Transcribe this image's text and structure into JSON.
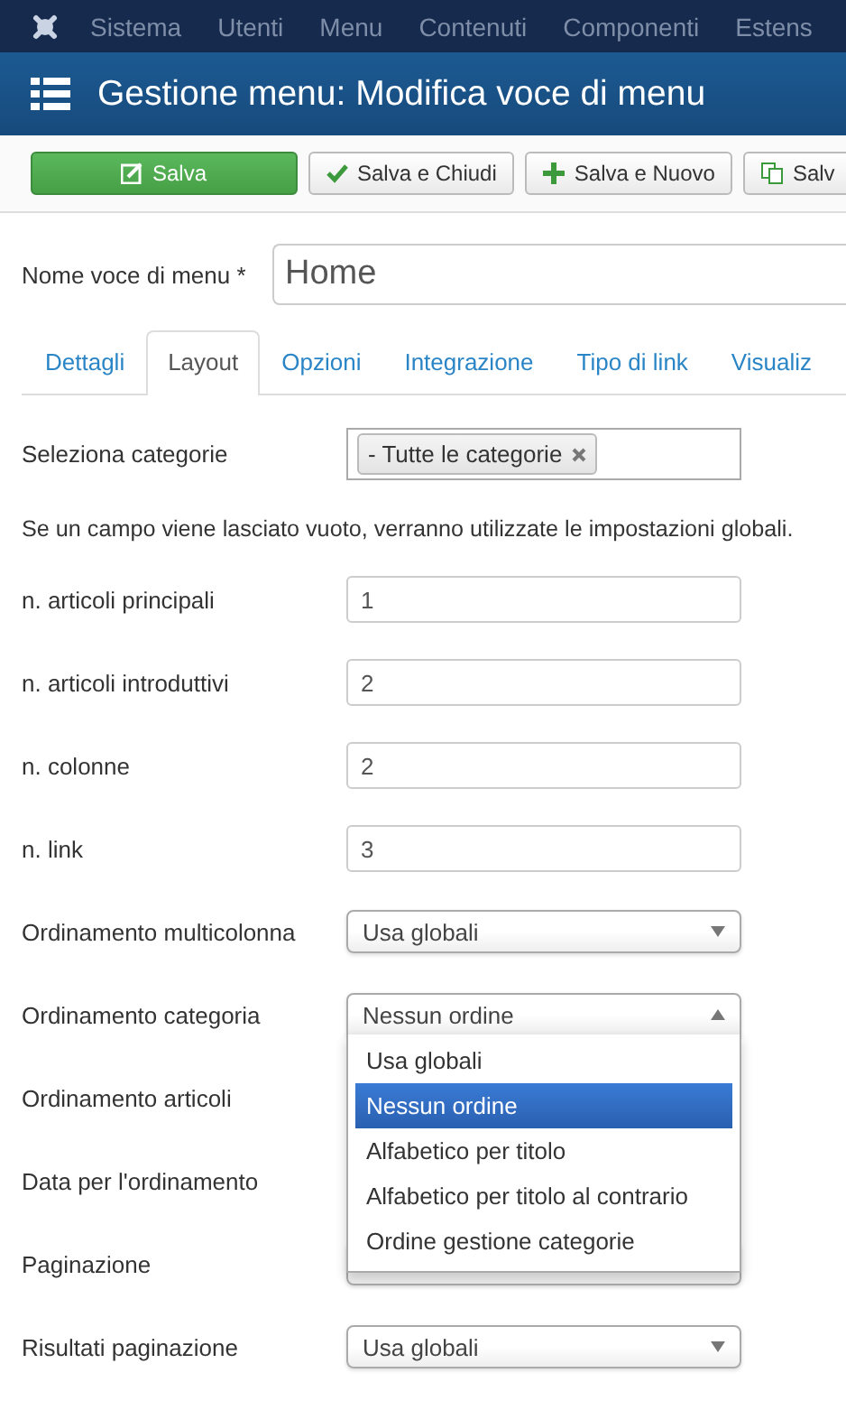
{
  "top_menu": [
    "Sistema",
    "Utenti",
    "Menu",
    "Contenuti",
    "Componenti",
    "Estens"
  ],
  "page_title": "Gestione menu: Modifica voce di menu",
  "toolbar": [
    {
      "label": "Salva",
      "kind": "primary"
    },
    {
      "label": "Salva e Chiudi",
      "kind": "default"
    },
    {
      "label": "Salva e Nuovo",
      "kind": "default"
    },
    {
      "label": "Salv",
      "kind": "default"
    }
  ],
  "title_field": {
    "label": "Nome voce di menu *",
    "value": "Home"
  },
  "tabs": [
    {
      "label": "Dettagli",
      "selected": false
    },
    {
      "label": "Layout",
      "selected": true
    },
    {
      "label": "Opzioni",
      "selected": false
    },
    {
      "label": "Integrazione",
      "selected": false
    },
    {
      "label": "Tipo di link",
      "selected": false
    },
    {
      "label": "Visualiz",
      "selected": false
    }
  ],
  "fields": [
    {
      "kind": "tags",
      "label": "Seleziona categorie",
      "tags": [
        "- Tutte le categorie"
      ]
    },
    {
      "kind": "note",
      "text": "Se un campo viene lasciato vuoto, verranno utilizzate le impostazioni globali."
    },
    {
      "kind": "text",
      "label": "n. articoli principali",
      "value": "1"
    },
    {
      "kind": "text",
      "label": "n. articoli introduttivi",
      "value": "2"
    },
    {
      "kind": "text",
      "label": "n. colonne",
      "value": "2"
    },
    {
      "kind": "text",
      "label": "n. link",
      "value": "3"
    },
    {
      "kind": "select",
      "label": "Ordinamento multicolonna",
      "value": "Usa globali",
      "expanded": false
    },
    {
      "kind": "select",
      "label": "Ordinamento categoria",
      "value": "Nessun ordine",
      "expanded": true,
      "options": [
        {
          "label": "Usa globali",
          "selected": false
        },
        {
          "label": "Nessun ordine",
          "selected": true
        },
        {
          "label": "Alfabetico per titolo",
          "selected": false
        },
        {
          "label": "Alfabetico per titolo al contrario",
          "selected": false
        },
        {
          "label": "Ordine gestione categorie",
          "selected": false
        }
      ]
    },
    {
      "kind": "covered",
      "label": "Ordinamento articoli"
    },
    {
      "kind": "covered",
      "label": "Data per l'ordinamento"
    },
    {
      "kind": "select",
      "label": "Paginazione"
    },
    {
      "kind": "select",
      "label": "Risultati paginazione",
      "value": "Usa globali",
      "expanded": false
    }
  ]
}
